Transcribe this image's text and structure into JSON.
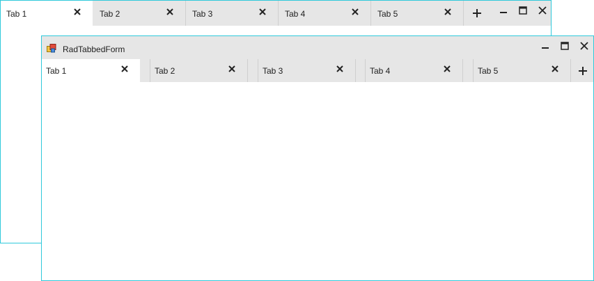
{
  "back_window": {
    "tabs": [
      {
        "label": "Tab 1",
        "active": true
      },
      {
        "label": "Tab 2",
        "active": false
      },
      {
        "label": "Tab 3",
        "active": false
      },
      {
        "label": "Tab 4",
        "active": false
      },
      {
        "label": "Tab 5",
        "active": false
      }
    ]
  },
  "front_window": {
    "title": "RadTabbedForm",
    "tabs": [
      {
        "label": "Tab 1",
        "active": true
      },
      {
        "label": "Tab 2",
        "active": false
      },
      {
        "label": "Tab 3",
        "active": false
      },
      {
        "label": "Tab 4",
        "active": false
      },
      {
        "label": "Tab 5",
        "active": false
      }
    ]
  },
  "icons": {
    "close_tab": "close-icon",
    "add_tab": "plus-icon",
    "minimize": "minimize-icon",
    "maximize": "maximize-icon",
    "close_window": "close-icon",
    "app": "app-icon"
  },
  "colors": {
    "window_border": "#2fc9db",
    "tabstrip_bg": "#e6e6e6",
    "active_tab_bg": "#ffffff"
  }
}
